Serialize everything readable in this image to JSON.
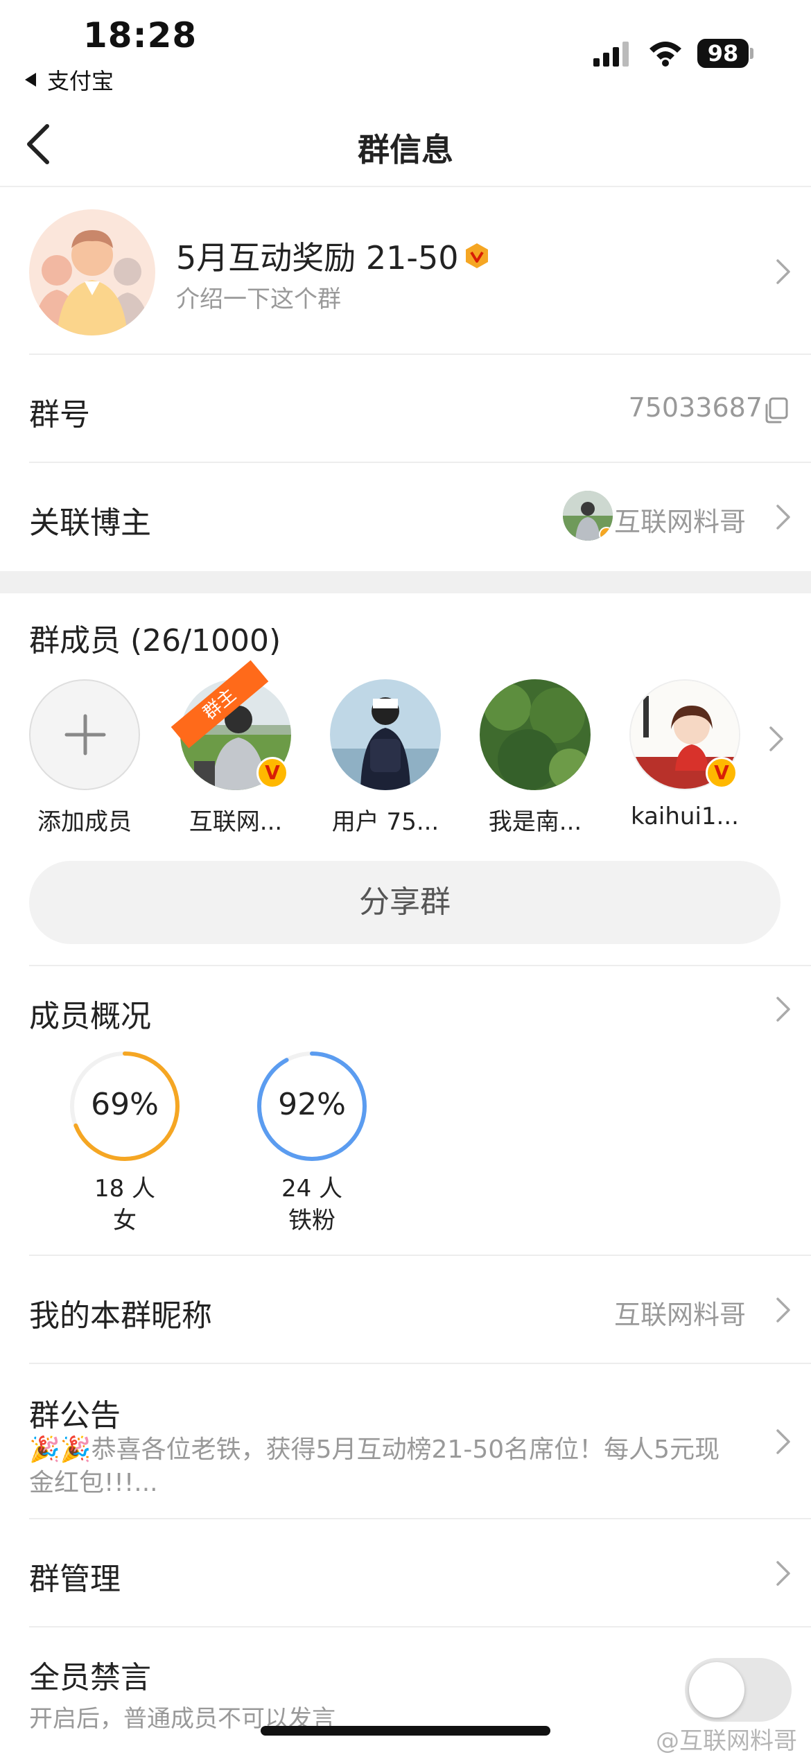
{
  "status_bar": {
    "time": "18:28",
    "back_app": "支付宝",
    "battery": "98"
  },
  "nav": {
    "title": "群信息"
  },
  "group": {
    "name": "5月互动奖励 21-50",
    "intro": "介绍一下这个群"
  },
  "group_number": {
    "label": "群号",
    "value": "75033687"
  },
  "blogger": {
    "label": "关联博主",
    "name": "互联网料哥"
  },
  "members": {
    "title": "群成员 (26/1000)",
    "add_label": "添加成员",
    "owner_tag": "群主",
    "list": [
      {
        "name": "互联网..."
      },
      {
        "name": "用户 75..."
      },
      {
        "name": "我是南..."
      },
      {
        "name": "kaihui1..."
      }
    ]
  },
  "share_button": "分享群",
  "overview": {
    "label": "成员概况",
    "stats": [
      {
        "percent_text": "69%",
        "value": 0.69,
        "count": "18 人",
        "caption": "女",
        "color": "#f5a623"
      },
      {
        "percent_text": "92%",
        "value": 0.92,
        "count": "24 人",
        "caption": "铁粉",
        "color": "#5b9cf0"
      }
    ]
  },
  "nickname": {
    "label": "我的本群昵称",
    "value": "互联网料哥"
  },
  "notice": {
    "label": "群公告",
    "text": "🎉🎉恭喜各位老铁，获得5月互动榜21-50名席位！每人5元现金红包!!!..."
  },
  "manage": {
    "label": "群管理"
  },
  "mute_all": {
    "label": "全员禁言",
    "sub": "开启后，普通成员不可以发言",
    "on": false
  },
  "watermark": "@互联网料哥"
}
